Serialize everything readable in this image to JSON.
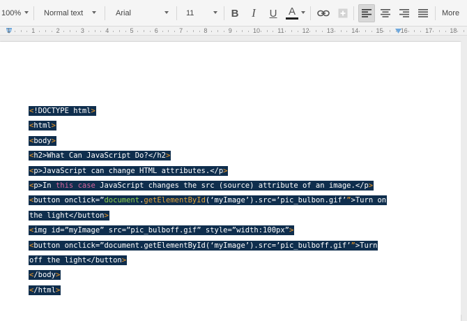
{
  "toolbar": {
    "zoom": "100%",
    "style": "Normal text",
    "font": "Arial",
    "size": "11",
    "more": "More",
    "icons": [
      "bold-icon",
      "italic-icon",
      "underline-icon",
      "text-color-icon",
      "link-icon",
      "comment-icon",
      "align-left-icon",
      "align-center-icon",
      "align-right-icon",
      "justify-icon"
    ],
    "text_color_bar": "#222222"
  },
  "ruler": {
    "numbers": [
      "1",
      "1",
      "2",
      "3",
      "4",
      "5",
      "6",
      "7",
      "8",
      "9",
      "10",
      "11",
      "12",
      "13",
      "14",
      "15",
      "16",
      "17",
      "18"
    ]
  },
  "code_lines": [
    [
      {
        "t": "<",
        "c": "ang"
      },
      {
        "t": "!DOCTYPE html",
        "c": "tag"
      },
      {
        "t": ">",
        "c": "ang"
      }
    ],
    [
      {
        "t": "<",
        "c": "ang"
      },
      {
        "t": "html",
        "c": "tag"
      },
      {
        "t": ">",
        "c": "ang"
      }
    ],
    [
      {
        "t": "<",
        "c": "ang"
      },
      {
        "t": "body",
        "c": "tag"
      },
      {
        "t": ">",
        "c": "ang"
      }
    ],
    [
      {
        "t": "<",
        "c": "ang"
      },
      {
        "t": "h2>What Can JavaScript Do?</h2",
        "c": "tag"
      },
      {
        "t": ">",
        "c": "ang"
      }
    ],
    [
      {
        "t": "<",
        "c": "ang"
      },
      {
        "t": "p>JavaScript can change HTML attributes.</p",
        "c": "tag"
      },
      {
        "t": ">",
        "c": "ang"
      }
    ],
    [
      {
        "t": "<",
        "c": "ang"
      },
      {
        "t": "p>In ",
        "c": "tag"
      },
      {
        "t": "this",
        "c": "kw"
      },
      {
        "t": " ",
        "c": "tag"
      },
      {
        "t": "case",
        "c": "kw"
      },
      {
        "t": " JavaScript changes the src (source) attribute of an image.</p",
        "c": "tag"
      },
      {
        "t": ">",
        "c": "ang"
      }
    ],
    [
      {
        "t": "<",
        "c": "ang"
      },
      {
        "t": "button onclick=”",
        "c": "tag"
      },
      {
        "t": "document",
        "c": "obj"
      },
      {
        "t": ".",
        "c": "tag"
      },
      {
        "t": "getElementById",
        "c": "fn"
      },
      {
        "t": "(‘myImage’).src=’pic_bulbon.gif’",
        "c": "tag"
      },
      {
        "t": "”",
        "c": "ang"
      },
      {
        "t": ">Turn on",
        "c": "tag"
      }
    ],
    [
      {
        "t": "the light</button",
        "c": "tag"
      },
      {
        "t": ">",
        "c": "ang"
      }
    ],
    [
      {
        "t": "<",
        "c": "ang"
      },
      {
        "t": "img id=”myImage” src=”pic_bulboff.gif” style=”width:100px”",
        "c": "tag"
      },
      {
        "t": ">",
        "c": "ang"
      }
    ],
    [
      {
        "t": "<",
        "c": "ang"
      },
      {
        "t": "button onclick=”document.getElementById(‘myImage’).src=’pic_bulboff.gif’",
        "c": "tag"
      },
      {
        "t": "”",
        "c": "ang"
      },
      {
        "t": ">Turn",
        "c": "tag"
      }
    ],
    [
      {
        "t": "off the light</button",
        "c": "tag"
      },
      {
        "t": ">",
        "c": "ang"
      }
    ],
    [
      {
        "t": "<",
        "c": "ang"
      },
      {
        "t": "/body",
        "c": "tag"
      },
      {
        "t": ">",
        "c": "ang"
      }
    ],
    [
      {
        "t": "<",
        "c": "ang"
      },
      {
        "t": "/html",
        "c": "tag"
      },
      {
        "t": ">",
        "c": "ang"
      }
    ]
  ]
}
